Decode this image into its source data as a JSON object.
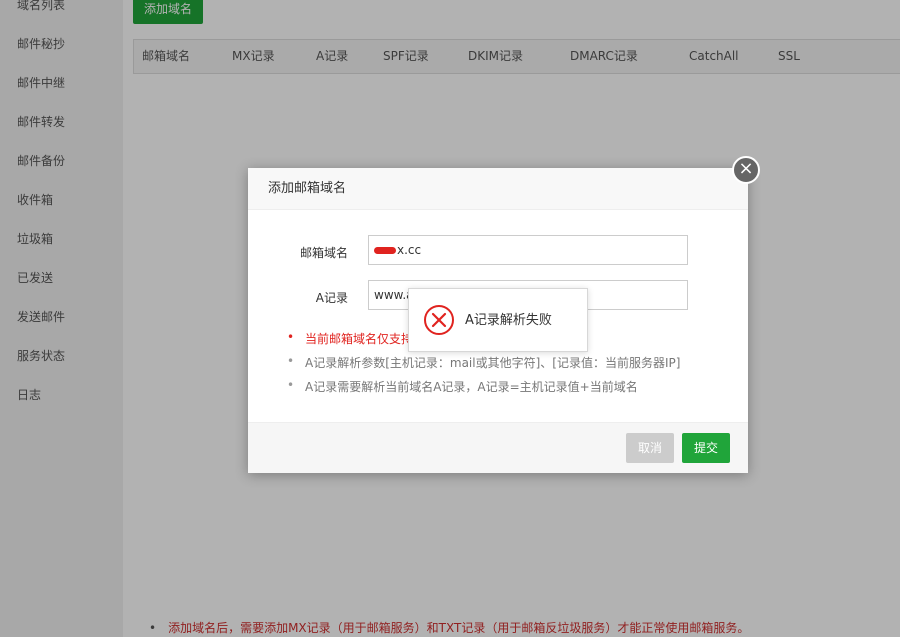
{
  "sidebar": {
    "items": [
      {
        "label": "域名列表"
      },
      {
        "label": "邮件秘抄"
      },
      {
        "label": "邮件中继"
      },
      {
        "label": "邮件转发"
      },
      {
        "label": "邮件备份"
      },
      {
        "label": "收件箱"
      },
      {
        "label": "垃圾箱"
      },
      {
        "label": "已发送"
      },
      {
        "label": "发送邮件"
      },
      {
        "label": "服务状态"
      },
      {
        "label": "日志"
      }
    ]
  },
  "main": {
    "add_domain_label": "添加域名",
    "columns": [
      "邮箱域名",
      "MX记录",
      "A记录",
      "SPF记录",
      "DKIM记录",
      "DMARC记录",
      "CatchAll",
      "SSL"
    ],
    "bottom_note": "添加域名后，需要添加MX记录（用于邮箱服务）和TXT记录（用于邮箱反垃圾服务）才能正常使用邮箱服务。"
  },
  "modal": {
    "title": "添加邮箱域名",
    "close_symbol": "×",
    "domain_label": "邮箱域名",
    "domain_value_visible": "x.cc",
    "a_label": "A记录",
    "a_value_visible": "www.a",
    "tips": [
      "当前邮箱域名仅支持",
      "A记录解析参数[主机记录：mail或其他字符]、[记录值：当前服务器IP]",
      "A记录需要解析当前域名A记录，A记录=主机记录值+当前域名"
    ],
    "cancel_label": "取消",
    "submit_label": "提交"
  },
  "toast": {
    "message": "A记录解析失败",
    "icon": "error-circle-icon"
  },
  "colors": {
    "primary_green": "#20a53a",
    "error_red": "#e0231f"
  }
}
